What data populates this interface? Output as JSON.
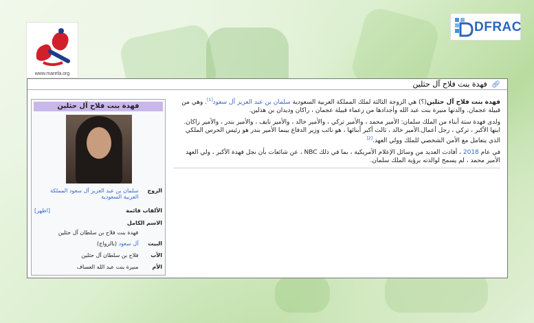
{
  "logos": {
    "left_url": "www.marefa.org",
    "right_text": "DFRAC"
  },
  "article": {
    "title": "فهدة بنت فلاح آل حثلين",
    "paragraphs": {
      "p1_bold": "فهدة بنت فلاح آل حثلين",
      "p1_a": "(؟) هي الزوجة الثالثة لملك المملكة العربية السعودية ",
      "p1_link": "سلمان بن عبد العزيز آل سعود",
      "p1_b": ". وهي من قبيلة عجمان. والدتها منيرة بنت عبد الله وأجدادها من زعماء قبيلة عجمان ، راكان وديدان بن هذلين.",
      "p1_ref": "[1]",
      "p2": "ولدى فهدة ستة أبناء من الملك سلمان: الأمير محمد ، والأمير تركي ، والأمير خالد ، والأمير نايف ، والأمير بندر ، والأمير راكان. ابنها الأكبر ، تركي ، رجل أعمال.الأمير خالد ، ثالث أكبر أبنائها ، هو نائب وزير الدفاع بينما الأمير بندر هو رئيس الحرس الملكي الذي يتعامل مع الأمن الشخصي للملك وولي العهد.",
      "p2_ref": "[2]",
      "p3_a": "في عام ",
      "p3_link": "2018",
      "p3_b": " ، أفادت العديد من وسائل الإعلام الأمريكية ، بما في ذلك NBC ، عن شائعات بأن نجل فهدة الأكبر ، ولي العهد الأمير محمد ، لم يسمح لوالدته برؤية الملك سلمان."
    }
  },
  "infobox": {
    "title": "فهدة بنت فلاح آل حثلين",
    "spouse_label": "الزوج",
    "spouse_value": "سلمان بن عبد العزيز آل سعود المملكة العربية السعودية",
    "titles_label": "الألقاب قائمة",
    "titles_toggle": "[اظهر]",
    "fullname_label": "الاسم الكامل",
    "fullname_value": "فهدة بنت فلاح بن سلطان آل حثلين",
    "house_label": "البيت",
    "house_value": "آل سعود",
    "house_note": "(بالزواج)",
    "father_label": "الأب",
    "father_value": "فلاح بن سلطان آل حثلين",
    "mother_label": "الأم",
    "mother_value": "منيرة بنت عبد الله العساف"
  },
  "colors": {
    "infobox_header": "#c9b7ea",
    "link": "#3366cc"
  }
}
